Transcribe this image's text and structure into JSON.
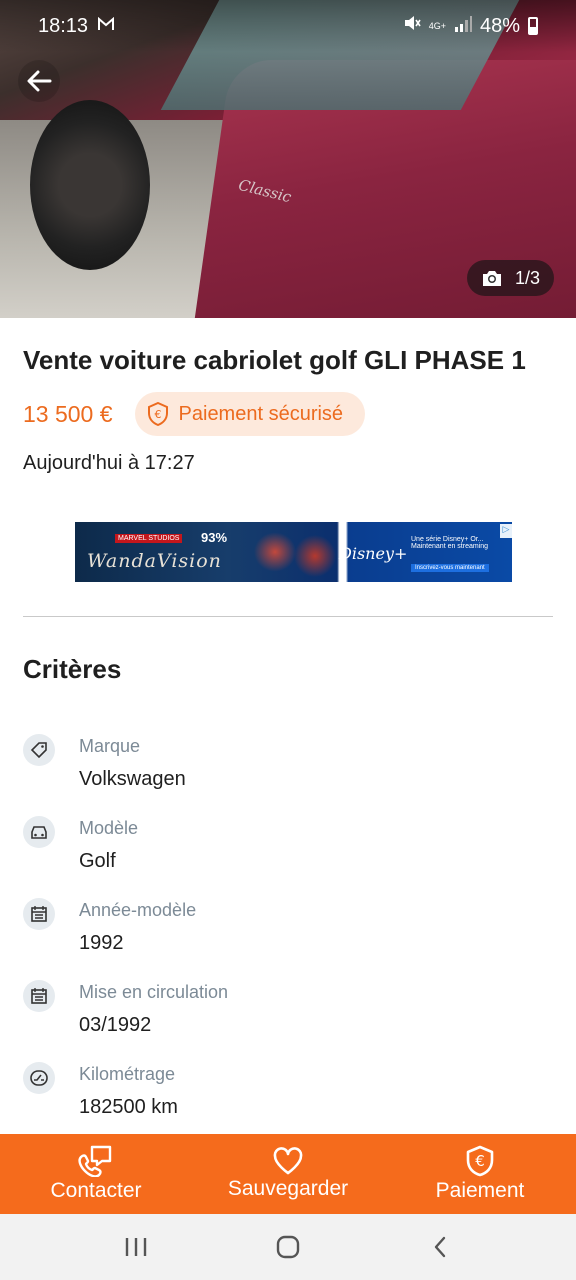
{
  "status_bar": {
    "time": "18:13",
    "network": "4G+",
    "battery": "48%"
  },
  "photo": {
    "counter": "1/3",
    "emblem_text": "Classic"
  },
  "listing": {
    "title": "Vente voiture cabriolet golf GLI PHASE 1",
    "price": "13 500 €",
    "secure_badge": "Paiement sécurisé",
    "date": "Aujourd'hui à 17:27"
  },
  "ad": {
    "brand": "MARVEL STUDIOS",
    "title": "WandaVision",
    "score": "93%",
    "platform": "Disney+",
    "tagline": "Une série Disney+ Or... Maintenant en streaming",
    "cta": "Inscrivez-vous maintenant"
  },
  "criteria": {
    "title": "Critères",
    "items": [
      {
        "label": "Marque",
        "value": "Volkswagen",
        "icon": "tag-icon"
      },
      {
        "label": "Modèle",
        "value": "Golf",
        "icon": "car-icon"
      },
      {
        "label": "Année-modèle",
        "value": "1992",
        "icon": "calendar-icon"
      },
      {
        "label": "Mise en circulation",
        "value": "03/1992",
        "icon": "calendar-icon"
      },
      {
        "label": "Kilométrage",
        "value": "182500 km",
        "icon": "speedometer-icon"
      }
    ]
  },
  "actions": {
    "contact": "Contacter",
    "save": "Sauvegarder",
    "payment": "Paiement"
  },
  "colors": {
    "accent": "#f56b1c",
    "price": "#ec6b1f",
    "badge_bg": "#fde9dc"
  }
}
